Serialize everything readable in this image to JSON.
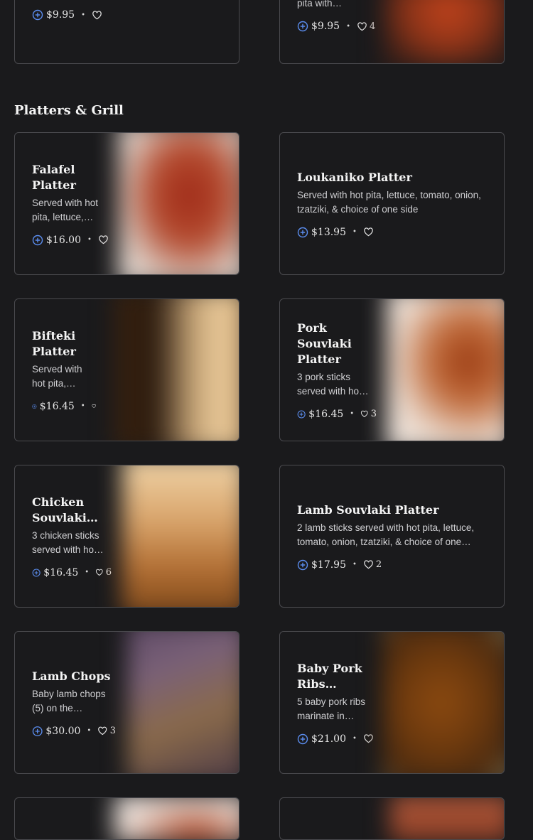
{
  "section_title": "Platters & Grill",
  "top_cards": [
    {
      "title": "",
      "desc": "",
      "price": "$9.95",
      "likes": ""
    },
    {
      "title": "",
      "desc": "pita with…",
      "price": "$9.95",
      "likes": "4"
    }
  ],
  "items": [
    {
      "title": "Falafel Platter",
      "desc": "Served with hot pita, lettuce,…",
      "price": "$16.00",
      "likes": ""
    },
    {
      "title": "Loukaniko Platter",
      "desc": "Served with hot pita, lettuce, tomato, onion, tzatziki, & choice of one side",
      "price": "$13.95",
      "likes": ""
    },
    {
      "title": "Bifteki Platter",
      "desc": "Served with hot pita,…",
      "price": "$16.45",
      "likes": ""
    },
    {
      "title": "Pork Souvlaki Platter",
      "desc": "3 pork sticks served with ho…",
      "price": "$16.45",
      "likes": "3"
    },
    {
      "title": "Chicken Souvlaki…",
      "desc": "3 chicken sticks served with ho…",
      "price": "$16.45",
      "likes": "6"
    },
    {
      "title": "Lamb Souvlaki Platter",
      "desc": "2 lamb sticks served with hot pita, lettuce, tomato, onion, tzatziki, & choice of one…",
      "price": "$17.95",
      "likes": "2"
    },
    {
      "title": "Lamb Chops",
      "desc": "Baby lamb chops (5) on the…",
      "price": "$30.00",
      "likes": "3"
    },
    {
      "title": "Baby Pork Ribs…",
      "desc": "5 baby pork ribs marinate in…",
      "price": "$21.00",
      "likes": ""
    }
  ],
  "colors": {
    "accent_plus": "#5b8def",
    "background": "#1a1a1c",
    "border": "#4a4a4e"
  },
  "icons": {
    "add": "plus-circle-icon",
    "like": "heart-outline-icon"
  }
}
